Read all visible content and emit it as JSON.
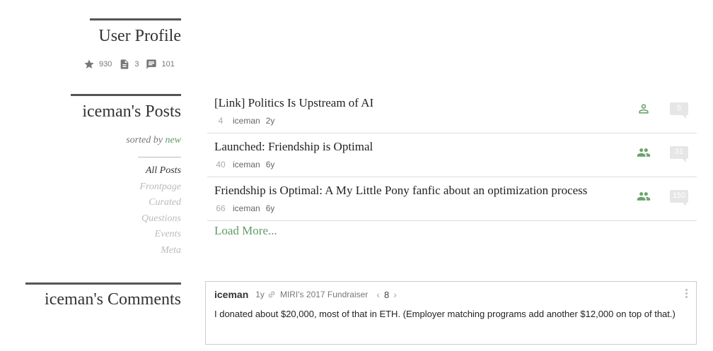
{
  "profile": {
    "title": "User Profile",
    "stats": {
      "karma": "930",
      "posts": "3",
      "comments": "101"
    }
  },
  "posts_section": {
    "title": "iceman's Posts",
    "sorted_by_prefix": "sorted by",
    "sorted_by_value": "new",
    "filters": [
      "All Posts",
      "Frontpage",
      "Curated",
      "Questions",
      "Events",
      "Meta"
    ],
    "active_filter": "All Posts",
    "posts": [
      {
        "title": "[Link] Politics Is Upstream of AI",
        "karma": "4",
        "author": "iceman",
        "age": "2y",
        "comments": "5",
        "audience_icon": "person-icon"
      },
      {
        "title": "Launched: Friendship is Optimal",
        "karma": "40",
        "author": "iceman",
        "age": "6y",
        "comments": "31",
        "audience_icon": "people-icon"
      },
      {
        "title": "Friendship is Optimal: A My Little Pony fanfic about an optimization process",
        "karma": "66",
        "author": "iceman",
        "age": "6y",
        "comments": "150",
        "audience_icon": "people-icon"
      }
    ],
    "load_more": "Load More..."
  },
  "comments_section": {
    "title": "iceman's Comments",
    "comment": {
      "author": "iceman",
      "age": "1y",
      "post": "MIRI's 2017 Fundraiser",
      "score": "8",
      "body": "I donated about $20,000, most of that in ETH. (Employer matching programs add another $12,000 on top of that.)"
    }
  },
  "colors": {
    "accent": "#5f9b65",
    "muted": "#bbbbbb",
    "rule": "#555555"
  }
}
